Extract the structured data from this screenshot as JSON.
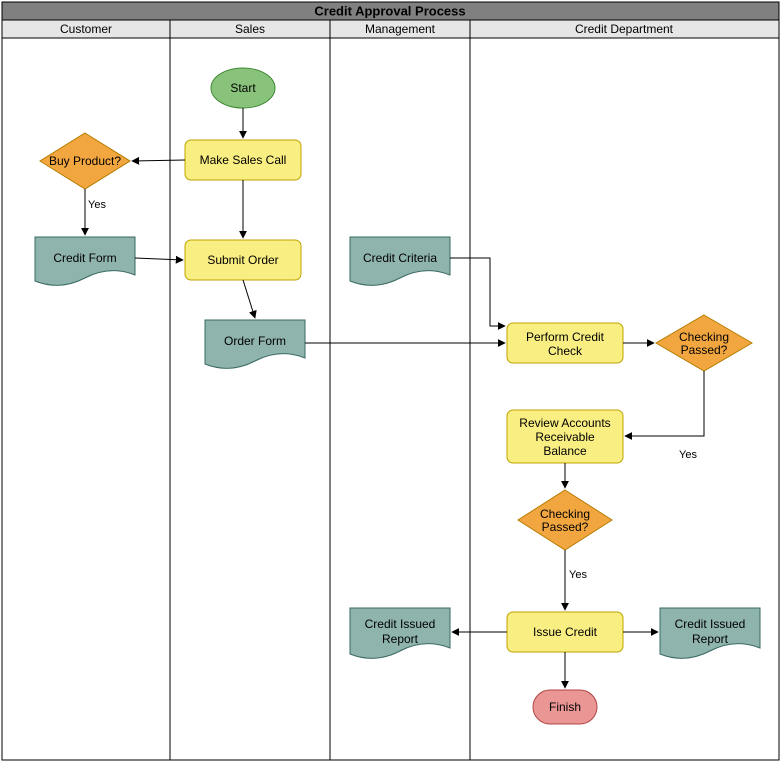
{
  "title": "Credit Approval Process",
  "lanes": {
    "customer": "Customer",
    "sales": "Sales",
    "management": "Management",
    "credit": "Credit Department"
  },
  "nodes": {
    "start": "Start",
    "finish": "Finish",
    "buy_product": "Buy Product?",
    "credit_form": "Credit Form",
    "make_sales_call": "Make Sales Call",
    "submit_order": "Submit Order",
    "order_form": "Order Form",
    "credit_criteria": "Credit Criteria",
    "perform_credit_check_l1": "Perform Credit",
    "perform_credit_check_l2": "Check",
    "checking_passed1_l1": "Checking",
    "checking_passed1_l2": "Passed?",
    "review_ar_l1": "Review Accounts",
    "review_ar_l2": "Receivable",
    "review_ar_l3": "Balance",
    "checking_passed2_l1": "Checking",
    "checking_passed2_l2": "Passed?",
    "issue_credit": "Issue Credit",
    "credit_report_left_l1": "Credit Issued",
    "credit_report_left_l2": "Report",
    "credit_report_right_l1": "Credit Issued",
    "credit_report_right_l2": "Report"
  },
  "edge_labels": {
    "buy_yes": "Yes",
    "cp1_yes": "Yes",
    "cp2_yes": "Yes"
  }
}
